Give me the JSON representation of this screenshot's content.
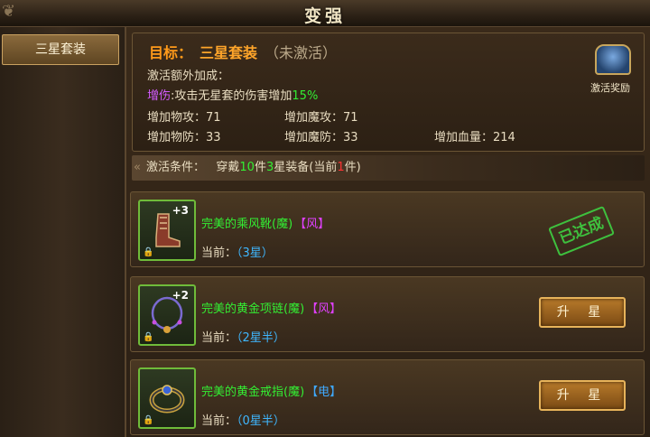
{
  "window": {
    "title": "变强"
  },
  "sidebar": {
    "items": [
      {
        "label": "三星套装",
        "selected": true
      }
    ]
  },
  "goal": {
    "label": "目标：",
    "name": "三星套装",
    "status": "（未激活）"
  },
  "bonus": {
    "title": "激活额外加成：",
    "effect_tag": "增伤",
    "effect_text": ":攻击无星套的伤害增加",
    "effect_pct": "15%"
  },
  "stats": {
    "phys_atk": "增加物攻：71",
    "mag_atk": "增加魔攻：71",
    "phys_def": "增加物防：33",
    "mag_def": "增加魔防：33",
    "hp": "增加血量：214"
  },
  "reward": {
    "label": "激活奖励",
    "icon": "treasure-chest-icon"
  },
  "condition": {
    "label": "激活条件：",
    "text_1": "穿戴",
    "count": "10",
    "text_2": "件",
    "stars": "3",
    "text_3": "星装备(当前",
    "current": "1",
    "text_4": "件)"
  },
  "items": [
    {
      "name": "完美的乘风靴(魔)",
      "element": "【风】",
      "element_color": "#e040ff",
      "plus": "+3",
      "current_label": "当前：",
      "current_value": "（3星）",
      "action": "已达成",
      "icon": "boots-icon"
    },
    {
      "name": "完美的黄金项链(魔)",
      "element": "【风】",
      "element_color": "#e040ff",
      "plus": "+2",
      "current_label": "当前：",
      "current_value": "（2星半）",
      "action": "升 星",
      "icon": "necklace-icon"
    },
    {
      "name": "完美的黄金戒指(魔)",
      "element": "【电】",
      "element_color": "#3fa9ff",
      "plus": "",
      "current_label": "当前：",
      "current_value": "（0星半）",
      "action": "升 星",
      "icon": "ring-icon"
    }
  ],
  "colors": {
    "goal_orange": "#ff9a1a",
    "stat_green": "#33ee33",
    "stat_blue": "#3fb7ff",
    "button_gold": "#e7b35a"
  }
}
